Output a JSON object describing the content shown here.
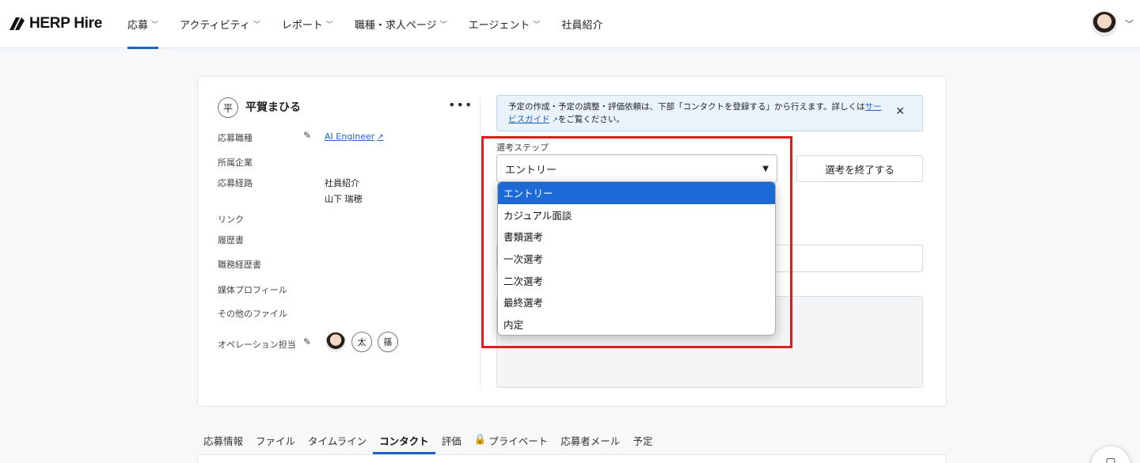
{
  "header": {
    "logo_text": "HERP Hire",
    "nav": [
      {
        "label": "応募",
        "chevron": true,
        "active": true
      },
      {
        "label": "アクティビティ",
        "chevron": true
      },
      {
        "label": "レポート",
        "chevron": true
      },
      {
        "label": "職種・求人ページ",
        "chevron": true
      },
      {
        "label": "エージェント",
        "chevron": true
      },
      {
        "label": "社員紹介",
        "chevron": false
      }
    ]
  },
  "candidate": {
    "initial": "平",
    "name": "平賀まひる",
    "more": "•••",
    "fields": {
      "job_label": "応募職種",
      "job_value": "AI Engineer",
      "company_label": "所属企業",
      "route_label": "応募経路",
      "route_value_1": "社員紹介",
      "route_value_2": "山下 瑞穂",
      "link_label": "リンク",
      "resume_label": "履歴書",
      "career_label": "職務経歴書",
      "media_label": "媒体プロフィール",
      "other_files_label": "その他のファイル",
      "operator_label": "オペレーション担当"
    },
    "operators": [
      "太",
      "篠"
    ]
  },
  "notice": {
    "text_before": "予定の作成・予定の調整・評価依頼は、下部「コンタクトを登録する」から行えます。詳しくは",
    "link": "サービスガイド",
    "text_after": "をご覧ください。",
    "close": "✕"
  },
  "selection": {
    "label": "選考ステップ",
    "current": "エントリー",
    "end_button": "選考を終了する",
    "options": [
      "エントリー",
      "カジュアル面談",
      "書類選考",
      "一次選考",
      "二次選考",
      "最終選考",
      "内定"
    ]
  },
  "tabs": [
    "応募情報",
    "ファイル",
    "タイムライン",
    "コンタクト",
    "評価",
    "プライベート",
    "応募者メール",
    "予定"
  ],
  "active_tab": "コンタクト",
  "colors": {
    "accent": "#1e63c4",
    "highlight": "#e21b1b",
    "selected_option": "#1c6ad6"
  }
}
